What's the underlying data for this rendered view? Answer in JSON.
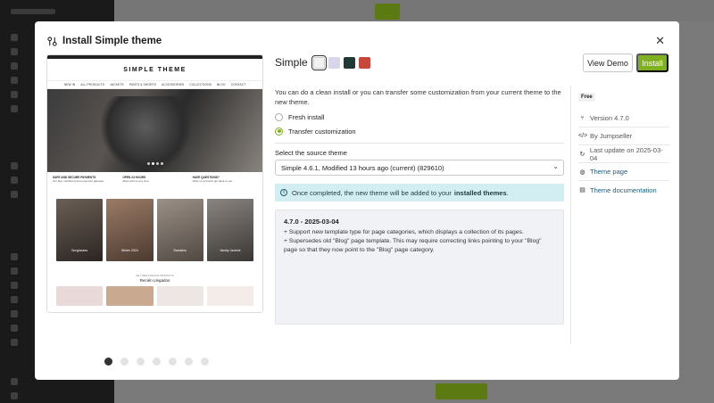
{
  "modal": {
    "title": "Install Simple theme",
    "close_icon": "close-icon"
  },
  "preview": {
    "logo": "SIMPLE THEME",
    "nav": [
      "NEW IN",
      "ALL PRODUCTS",
      "JACKETS",
      "PANTS & SHORTS",
      "ACCESSORIES",
      "COLLECTIONS",
      "BLOG",
      "CONTACT"
    ],
    "info": [
      {
        "title": "SAFE AND SECURE PAYMENTS",
        "text": "Our fast, certified secure payment gateway"
      },
      {
        "title": "OPEN 24 HOURS",
        "text": "Shop with us any time"
      },
      {
        "title": "HAVE QUESTIONS?",
        "text": "Write us and we'll get back to you"
      }
    ],
    "cards": [
      {
        "label": "Sunglasses"
      },
      {
        "label": "Winter 2024"
      },
      {
        "label": "Sweaters"
      },
      {
        "label": "Varsity Jackets"
      }
    ],
    "section_title": "Recién Llegados",
    "section_sub": "GET NEW FASHION PRODUCTS"
  },
  "carousel": {
    "count": 7,
    "active": 0
  },
  "theme": {
    "name": "Simple",
    "swatches": [
      {
        "color": "#f2f2f2",
        "selected": true
      },
      {
        "color": "#d8d6ea",
        "selected": false
      },
      {
        "color": "#1d3a34",
        "selected": false
      },
      {
        "color": "#c9463a",
        "selected": false
      }
    ]
  },
  "actions": {
    "view_demo": "View Demo",
    "install": "Install"
  },
  "install_options": {
    "description": "You can do a clean install or you can transfer some customization from your current theme to the new theme.",
    "fresh_install": "Fresh install",
    "transfer_customization": "Transfer customization",
    "selected": "transfer"
  },
  "source": {
    "label": "Select the source theme",
    "value": "Simple 4.6.1, Modified 13 hours ago (current) (829610)"
  },
  "alert": {
    "text": "Once completed, the new theme will be added to your",
    "link": "installed themes",
    "suffix": "."
  },
  "changelog": {
    "title": "4.7.0 - 2025-03-04",
    "lines": [
      "+ Support new template type for page categories, which displays a collection of its pages.",
      "+ Supersedes old \"Blog\" page template. This may require correcting links pointing to your \"Blog\" page so that they now point to the \"Blog\" page category."
    ]
  },
  "meta": {
    "badge": "Free",
    "version": "Version 4.7.0",
    "author": "By Jumpseller",
    "last_update": "Last update on 2025-03-04",
    "theme_page": "Theme page",
    "theme_docs": "Theme documentation"
  }
}
